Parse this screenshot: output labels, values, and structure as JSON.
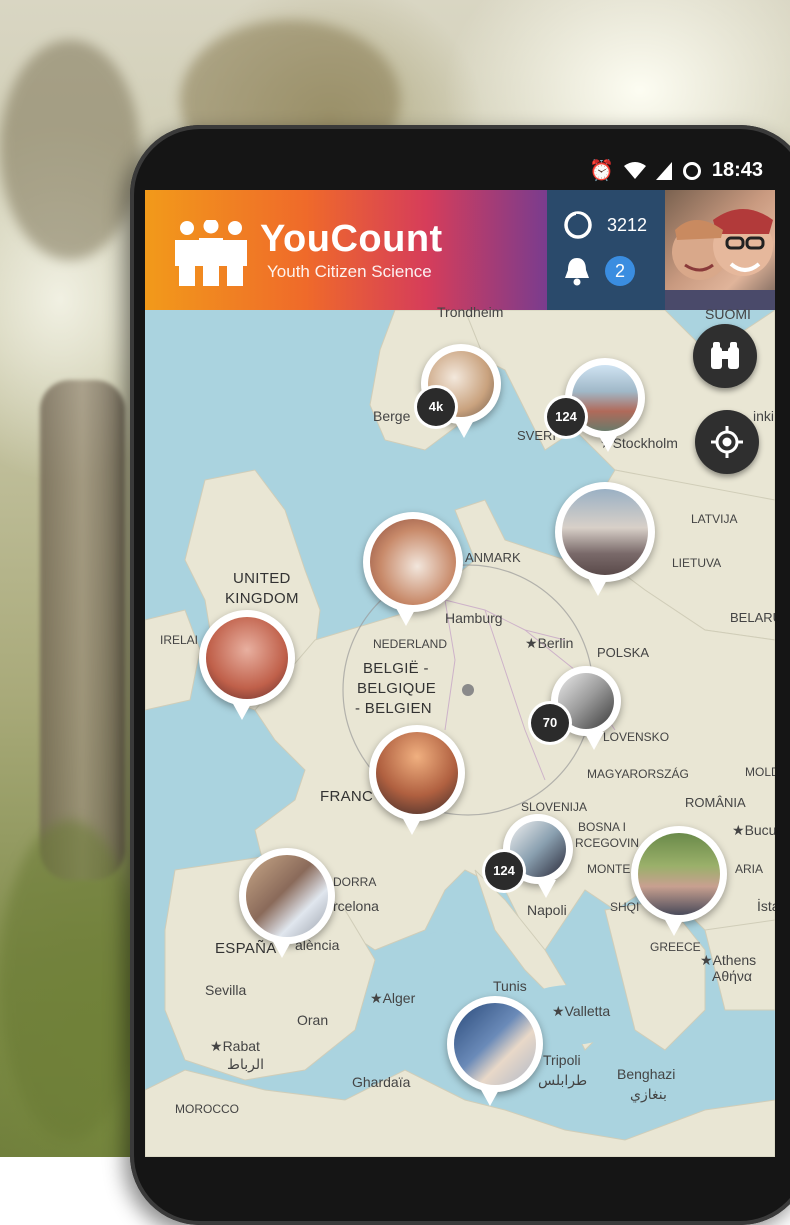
{
  "status_bar": {
    "time": "18:43"
  },
  "app": {
    "name": "YouCount",
    "subtitle": "Youth Citizen Science"
  },
  "stats": {
    "points": "3212",
    "notifications": "2"
  },
  "map": {
    "labels": {
      "trondheim": "Trondheim",
      "suomi": "SUOMI",
      "bergen": "Berge",
      "sverige": "SVERI",
      "stockholm": "Stockholm",
      "helsinki": "inki",
      "latvija": "LATVIJA",
      "lietuva": "LIETUVA",
      "danmark": "ANMARK",
      "uk1": "UNITED",
      "uk2": "KINGDOM",
      "ireland": "IRELAI",
      "hamburg": "Hamburg",
      "berlin": "Berlin",
      "nederland": "NEDERLAND",
      "polska": "POLSKA",
      "belarus": "BELARUS",
      "belgie1": "BELGIË -",
      "belgie2": "BELGIQUE",
      "belgie3": "- BELGIEN",
      "slovensko": "LOVENSKO",
      "france": "FRANC",
      "magyar": "MAGYARORSZÁG",
      "moldova": "MOLD",
      "romania": "ROMÂNIA",
      "slovenija": "SLOVENIJA",
      "bosna1": "BOSNA I",
      "bosna2": "RCEGOVIN",
      "bucuresti": "Bucur",
      "andorra": "DORRA",
      "barcelona": "rcelona",
      "montenegro": "MONTE",
      "shqip": "SHQI",
      "aria": "ARIA",
      "istanbul": "İstar",
      "napoli": "Napoli",
      "espana": "ESPAÑA",
      "valencia": "alència",
      "greece": "GREECE",
      "athens1": "Athens",
      "athens2": "Αθήνα",
      "sevilla": "Sevilla",
      "alger": "Alger",
      "tunis": "Tunis",
      "valletta": "Valletta",
      "oran": "Oran",
      "rabat1": "Rabat",
      "rabat2": "الرباط",
      "tripoli1": "Tripoli",
      "tripoli2": "طرابلس",
      "benghazi1": "Benghazi",
      "benghazi2": "بنغازي",
      "ghardaia": "Ghardaïa",
      "morocco": "MOROCCO"
    },
    "clusters": {
      "norway": "4k",
      "sweden": "124",
      "germany": "70",
      "italy": "124"
    }
  },
  "colors": {
    "stats_bg": "#2a4a6b",
    "badge": "#3a8de0",
    "water": "#aad3df",
    "land": "#e9e6d4"
  },
  "icons": [
    "alarm-icon",
    "wifi-icon",
    "signal-icon",
    "battery-icon",
    "people-logo-icon",
    "points-icon",
    "bell-icon",
    "binoculars-icon",
    "locate-icon"
  ]
}
